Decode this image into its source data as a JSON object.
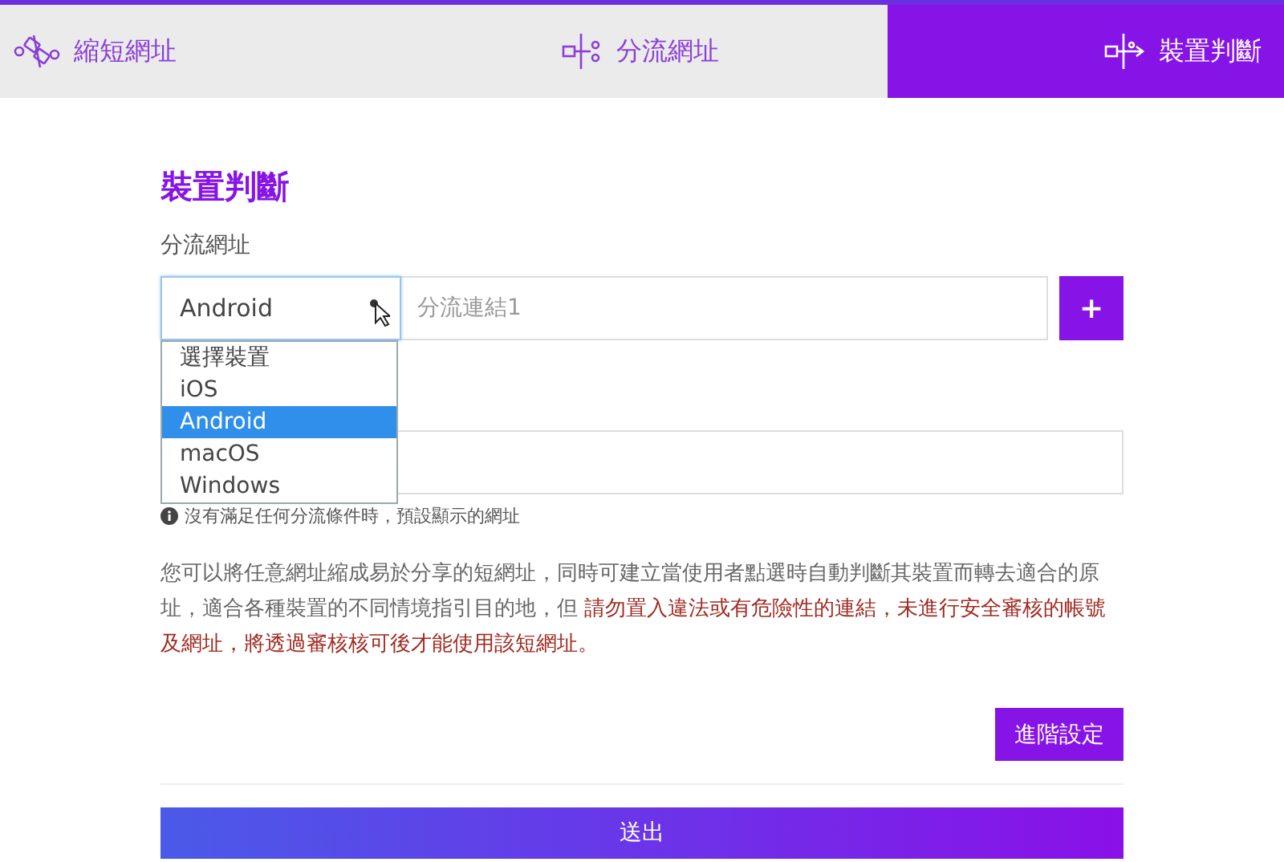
{
  "tabs": [
    {
      "label": "縮短網址",
      "kind": "link",
      "selected": false
    },
    {
      "label": "分流網址",
      "kind": "split",
      "selected": false
    },
    {
      "label": "裝置判斷",
      "kind": "device",
      "selected": true
    }
  ],
  "form": {
    "title": "裝置判斷",
    "label": "分流網址",
    "device_select": {
      "value": "Android",
      "expanded": true,
      "options": [
        {
          "label": "選擇裝置",
          "selected": false
        },
        {
          "label": "iOS",
          "selected": false
        },
        {
          "label": "Android",
          "selected": true
        },
        {
          "label": "macOS",
          "selected": false
        },
        {
          "label": "Windows",
          "selected": false
        }
      ]
    },
    "link_field": {
      "placeholder": "分流連結1"
    },
    "add_button": "+",
    "hint": "沒有滿足任何分流條件時，預設顯示的網址",
    "description": {
      "text": "您可以將任意網址縮成易於分享的短網址，同時可建立當使用者點選時自動判斷其裝置而轉去適合的原址，適合各種裝置的不同情境指引目的地，但 ",
      "warning": "請勿置入違法或有危險性的連結，未進行安全審核的帳號及網址，將透過審核核可後才能使用該短網址。"
    },
    "advanced_button": "進階設定",
    "submit_button": "送出"
  }
}
